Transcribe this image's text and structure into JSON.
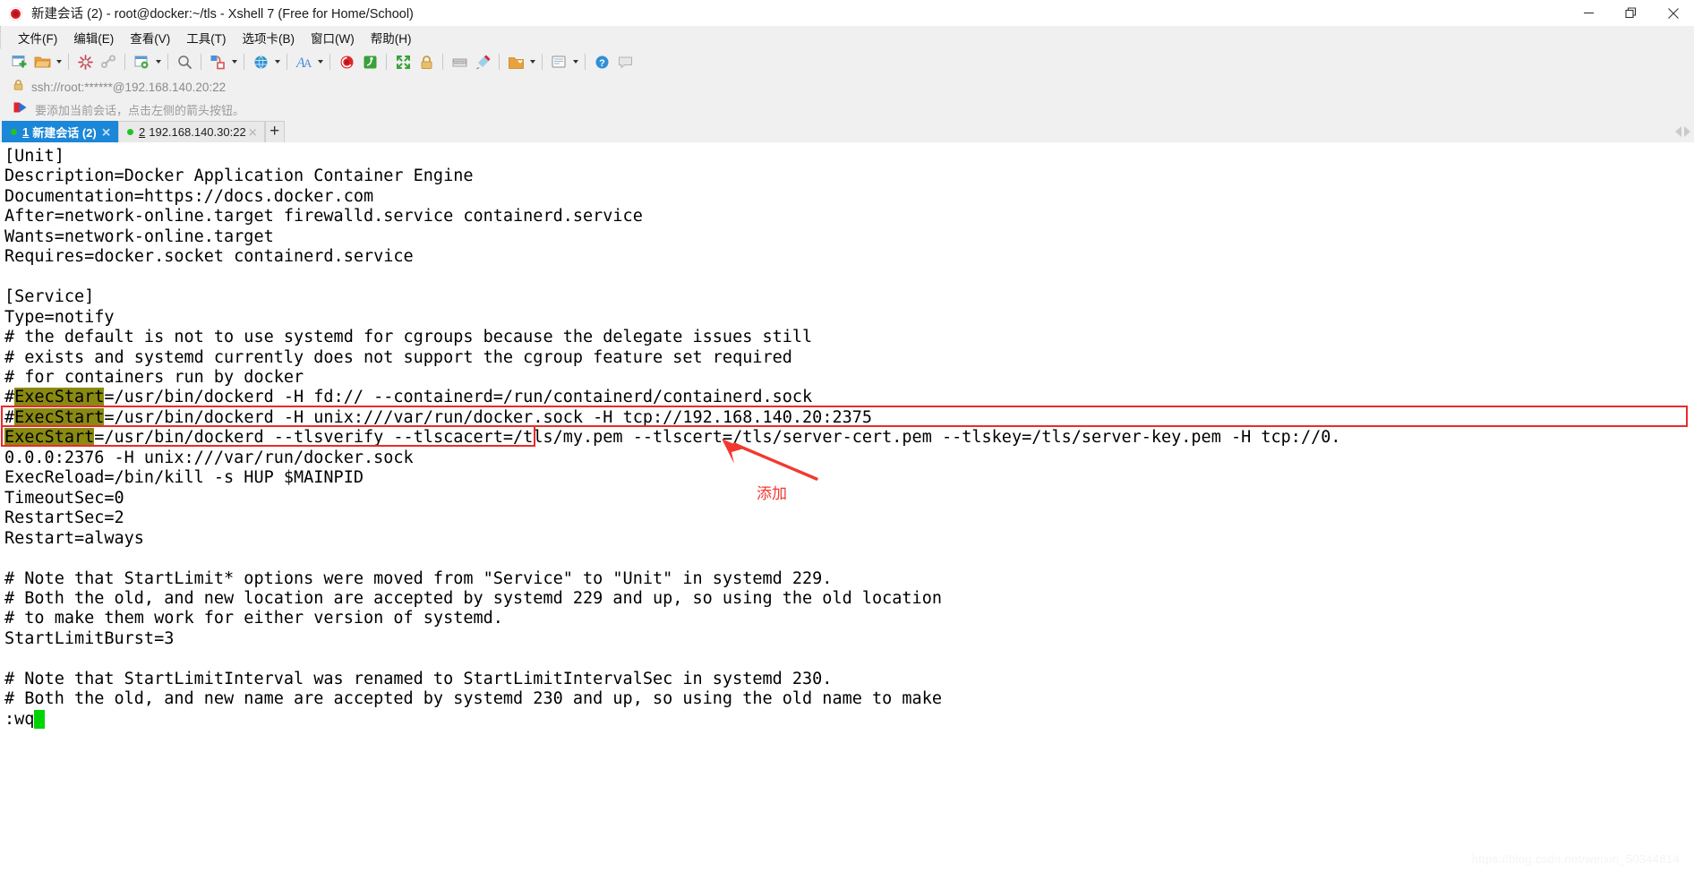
{
  "window": {
    "title": "新建会话 (2) - root@docker:~/tls - Xshell 7 (Free for Home/School)",
    "logo_icon": "xshell-logo-icon",
    "minimize_label": "最小化",
    "restore_label": "还原",
    "close_label": "关闭"
  },
  "menubar": {
    "items": [
      {
        "label": "文件(F)",
        "name": "menu-file"
      },
      {
        "label": "编辑(E)",
        "name": "menu-edit"
      },
      {
        "label": "查看(V)",
        "name": "menu-view"
      },
      {
        "label": "工具(T)",
        "name": "menu-tools"
      },
      {
        "label": "选项卡(B)",
        "name": "menu-tabs"
      },
      {
        "label": "窗口(W)",
        "name": "menu-window"
      },
      {
        "label": "帮助(H)",
        "name": "menu-help"
      }
    ]
  },
  "toolbar": {
    "items": [
      {
        "icon": "new-session-icon",
        "caret": false
      },
      {
        "icon": "open-folder-icon",
        "caret": true
      },
      {
        "sep": true
      },
      {
        "icon": "disconnect-icon",
        "caret": false
      },
      {
        "icon": "reconnect-icon",
        "caret": false
      },
      {
        "sep": true
      },
      {
        "icon": "session-properties-icon",
        "caret": true
      },
      {
        "sep": true
      },
      {
        "icon": "find-icon",
        "caret": false
      },
      {
        "sep": true
      },
      {
        "icon": "file-transfer-icon",
        "caret": true
      },
      {
        "sep": true
      },
      {
        "icon": "globe-icon",
        "caret": true
      },
      {
        "sep": true
      },
      {
        "icon": "font-icon",
        "caret": true
      },
      {
        "sep": true
      },
      {
        "icon": "xshell-icon",
        "caret": false
      },
      {
        "icon": "xftp-icon",
        "caret": false
      },
      {
        "sep": true
      },
      {
        "icon": "fullscreen-icon",
        "caret": false
      },
      {
        "icon": "lock-icon",
        "caret": false
      },
      {
        "sep": true
      },
      {
        "icon": "keyboard-icon",
        "caret": false
      },
      {
        "icon": "highlight-icon",
        "caret": false
      },
      {
        "sep": true
      },
      {
        "icon": "layout-icon",
        "caret": true
      },
      {
        "sep": true
      },
      {
        "icon": "compose-icon",
        "caret": true
      },
      {
        "sep": true
      },
      {
        "icon": "help-icon",
        "caret": false
      },
      {
        "icon": "chat-icon",
        "caret": false
      }
    ]
  },
  "address_bar": {
    "lock_icon": "lock-icon",
    "value": "ssh://root:******@192.168.140.20:22"
  },
  "hint_bar": {
    "flag_icon": "bookmark-flag-icon",
    "text": "要添加当前会话，点击左侧的箭头按钮。"
  },
  "tabs": {
    "items": [
      {
        "num": "1",
        "label": "新建会话 (2)",
        "active": true,
        "close": "✕",
        "status": "connected"
      },
      {
        "num": "2",
        "label": "192.168.140.30:22",
        "active": false,
        "close": "✕",
        "status": "connected"
      }
    ],
    "new_tab_label": "+",
    "scroll_left_icon": "chevron-left-icon",
    "scroll_right_icon": "chevron-right-icon"
  },
  "terminal": {
    "lines": [
      {
        "text": "[Unit]"
      },
      {
        "text": "Description=Docker Application Container Engine"
      },
      {
        "text": "Documentation=https://docs.docker.com"
      },
      {
        "text": "After=network-online.target firewalld.service containerd.service"
      },
      {
        "text": "Wants=network-online.target"
      },
      {
        "text": "Requires=docker.socket containerd.service"
      },
      {
        "text": ""
      },
      {
        "text": "[Service]"
      },
      {
        "text": "Type=notify"
      },
      {
        "text": "# the default is not to use systemd for cgroups because the delegate issues still"
      },
      {
        "text": "# exists and systemd currently does not support the cgroup feature set required"
      },
      {
        "text": "# for containers run by docker"
      },
      {
        "text": "#",
        "hl": "ExecStart",
        "rest": "=/usr/bin/dockerd -H fd:// --containerd=/run/containerd/containerd.sock"
      },
      {
        "text": "#",
        "hl": "ExecStart",
        "rest": "=/usr/bin/dockerd -H unix:///var/run/docker.sock -H tcp://192.168.140.20:2375"
      },
      {
        "text": "",
        "hl": "ExecStart",
        "rest": "=/usr/bin/dockerd --tlsverify --tlscacert=/tls/my.pem --tlscert=/tls/server-cert.pem --tlskey=/tls/server-key.pem -H tcp://0."
      },
      {
        "text": "0.0.0:2376 -H unix:///var/run/docker.sock"
      },
      {
        "text": "ExecReload=/bin/kill -s HUP $MAINPID"
      },
      {
        "text": "TimeoutSec=0"
      },
      {
        "text": "RestartSec=2"
      },
      {
        "text": "Restart=always"
      },
      {
        "text": ""
      },
      {
        "text": "# Note that StartLimit* options were moved from \"Service\" to \"Unit\" in systemd 229."
      },
      {
        "text": "# Both the old, and new location are accepted by systemd 229 and up, so using the old location"
      },
      {
        "text": "# to make them work for either version of systemd."
      },
      {
        "text": "StartLimitBurst=3"
      },
      {
        "text": ""
      },
      {
        "text": "# Note that StartLimitInterval was renamed to StartLimitIntervalSec in systemd 230."
      },
      {
        "text": "# Both the old, and new name are accepted by systemd 230 and up, so using the old name to make"
      },
      {
        "text": ":wq",
        "cursor": true
      }
    ],
    "highlight_bg": "#8a8a12",
    "cursor_color": "#00d400"
  },
  "annotations": {
    "callout_text": "添加",
    "arrow_icon": "red-arrow-icon",
    "box_color": "#ec2a2a"
  },
  "watermark": {
    "text": "https://blog.csdn.net/weixin_50344814"
  }
}
